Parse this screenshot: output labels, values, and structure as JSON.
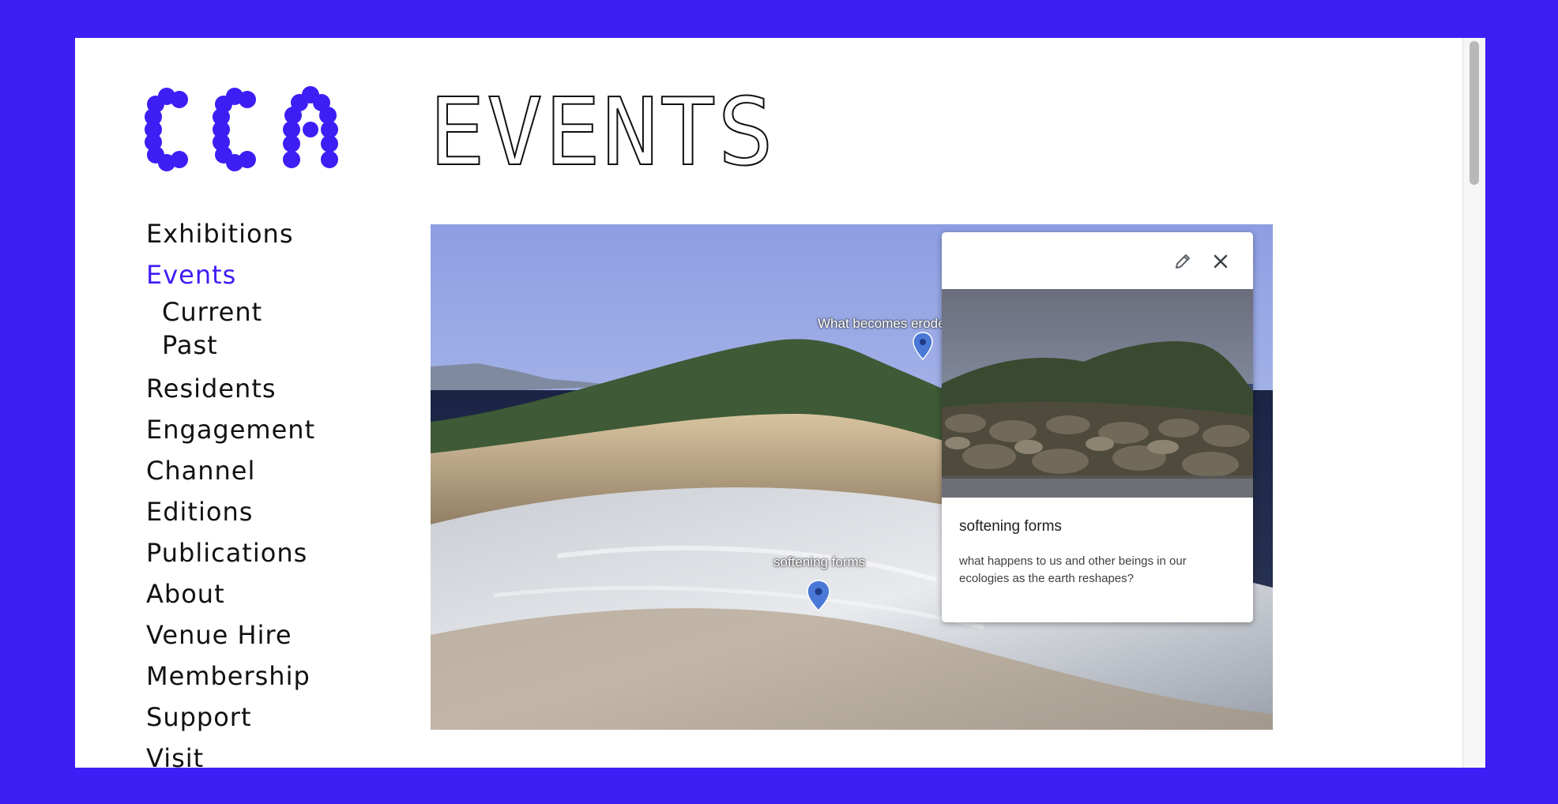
{
  "brand": {
    "logo_text": "CCA",
    "accent_color": "#3d1ef5",
    "background_color": "#3d1ef5"
  },
  "page": {
    "title": "Events"
  },
  "nav": {
    "items": [
      {
        "label": "Exhibitions"
      },
      {
        "label": "Events",
        "active": true
      },
      {
        "label": "Residents"
      },
      {
        "label": "Engagement"
      },
      {
        "label": "Channel"
      },
      {
        "label": "Editions"
      },
      {
        "label": "Publications"
      },
      {
        "label": "About"
      },
      {
        "label": "Venue Hire"
      },
      {
        "label": "Membership"
      },
      {
        "label": "Support"
      },
      {
        "label": "Visit"
      }
    ],
    "events_subitems": [
      {
        "label": "Current"
      },
      {
        "label": "Past"
      }
    ]
  },
  "map": {
    "pins": [
      {
        "label": "What becomes eroded"
      },
      {
        "label": "softening forms"
      }
    ],
    "card": {
      "title": "softening forms",
      "description": "what happens to us and other beings in our ecologies as the earth reshapes?",
      "edit_icon": "pencil-icon",
      "close_icon": "close-icon"
    }
  }
}
